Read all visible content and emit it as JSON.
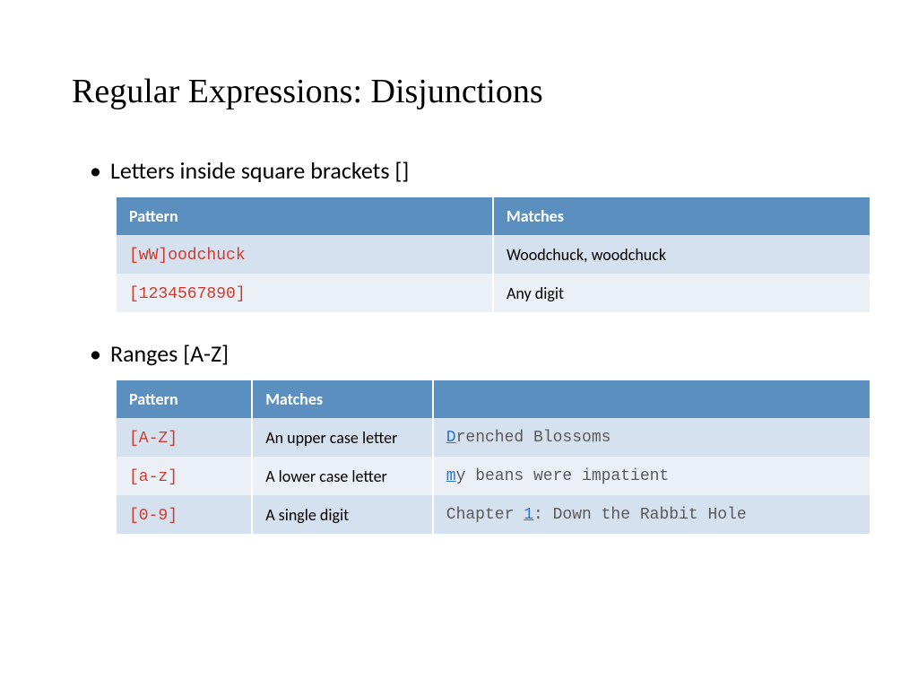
{
  "title": "Regular Expressions: Disjunctions",
  "section1": {
    "bullet": "Letters inside square brackets []",
    "headers": [
      "Pattern",
      "Matches"
    ],
    "rows": [
      {
        "pattern": "[wW]oodchuck",
        "matches": "Woodchuck, woodchuck"
      },
      {
        "pattern": "[1234567890]",
        "matches": "Any digit"
      }
    ]
  },
  "section2": {
    "bullet": "Ranges [A-Z]",
    "headers": [
      "Pattern",
      "Matches",
      ""
    ],
    "rows": [
      {
        "pattern": "[A-Z]",
        "matches": "An upper case letter",
        "ex_hl": "D",
        "ex_rest": "renched Blossoms"
      },
      {
        "pattern": "[a-z]",
        "matches": "A lower case letter",
        "ex_hl": "m",
        "ex_rest": "y beans were impatient"
      },
      {
        "pattern": "[0-9]",
        "matches": "A single digit",
        "ex_pre": "Chapter ",
        "ex_hl": "1",
        "ex_rest": ": Down the Rabbit Hole"
      }
    ]
  }
}
